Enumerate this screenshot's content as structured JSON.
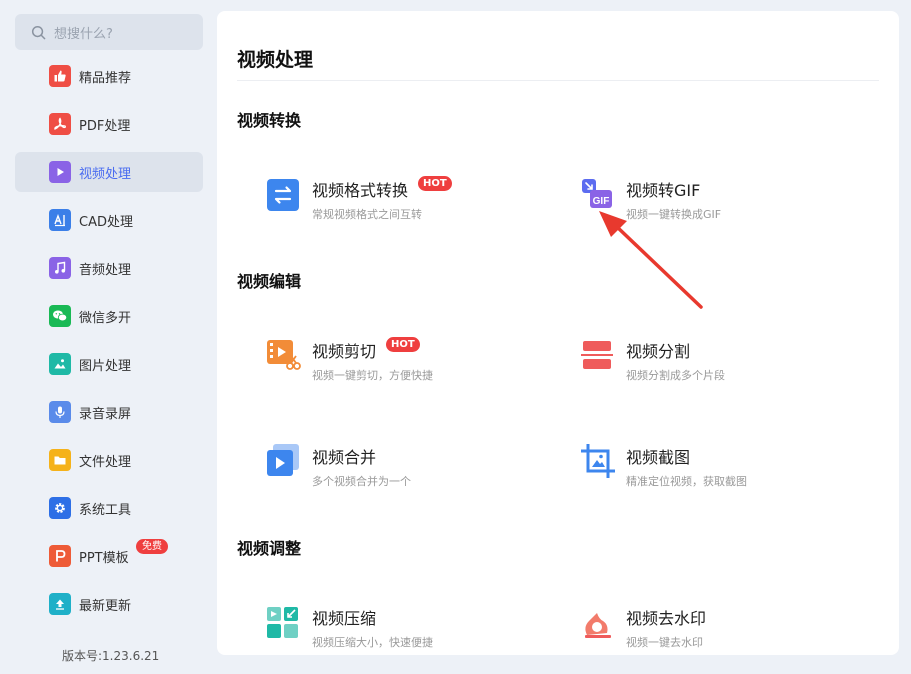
{
  "sidebar": {
    "search_placeholder": "想搜什么?",
    "items": [
      {
        "label": "精品推荐"
      },
      {
        "label": "PDF处理"
      },
      {
        "label": "视频处理"
      },
      {
        "label": "CAD处理"
      },
      {
        "label": "音频处理"
      },
      {
        "label": "微信多开"
      },
      {
        "label": "图片处理"
      },
      {
        "label": "录音录屏"
      },
      {
        "label": "文件处理"
      },
      {
        "label": "系统工具"
      },
      {
        "label": "PPT模板",
        "badge": "免费"
      },
      {
        "label": "最新更新"
      }
    ],
    "active_item": "视频处理",
    "version": "版本号:1.23.6.21"
  },
  "main": {
    "title": "视频处理",
    "sections": [
      {
        "title": "视频转换",
        "tools": [
          {
            "title": "视频格式转换",
            "badge": "HOT",
            "desc": "常规视频格式之间互转"
          },
          {
            "title": "视频转GIF",
            "desc": "视频一键转换成GIF"
          }
        ]
      },
      {
        "title": "视频编辑",
        "tools": [
          {
            "title": "视频剪切",
            "badge": "HOT",
            "desc": "视频一键剪切，方便快捷"
          },
          {
            "title": "视频分割",
            "desc": "视频分割成多个片段"
          },
          {
            "title": "视频合并",
            "desc": "多个视频合并为一个"
          },
          {
            "title": "视频截图",
            "desc": "精准定位视频，获取截图"
          }
        ]
      },
      {
        "title": "视频调整",
        "tools": [
          {
            "title": "视频压缩",
            "desc": "视频压缩大小，快速便捷"
          },
          {
            "title": "视频去水印",
            "desc": "视频一键去水印"
          }
        ]
      }
    ]
  },
  "colors": {
    "accent": "#4a6cf0",
    "hot_badge": "#ef3f3f",
    "annotation_arrow": "#e8392e"
  }
}
